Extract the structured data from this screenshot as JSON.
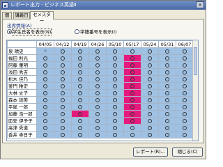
{
  "window": {
    "title": "レポート出力 - ビジネス英語Ⅱ",
    "close_label": "×"
  },
  "tabs": [
    {
      "label": "個別",
      "active": false
    },
    {
      "label": "講義日",
      "active": false
    },
    {
      "label": "セメスター",
      "active": true
    }
  ],
  "display_group": {
    "label": "出席情報(A)",
    "options": [
      {
        "label": "学生氏名を表示(N)",
        "selected": true
      },
      {
        "label": "学籍番号を表示(I)",
        "selected": false
      }
    ]
  },
  "grid": {
    "dates": [
      "04/05",
      "04/12",
      "04/19",
      "04/26",
      "05/10",
      "05/17",
      "05/24",
      "05/31",
      "06/07"
    ],
    "rows": [
      {
        "name": "泉 晴史",
        "marks": [
          "x",
          "o",
          "o",
          "o",
          "o",
          "o",
          "o",
          "o",
          "o"
        ]
      },
      {
        "name": "福田 利光",
        "marks": [
          "o",
          "o",
          "o",
          "o",
          "o",
          "o",
          "o",
          "o",
          "o"
        ]
      },
      {
        "name": "阿藤 董明",
        "marks": [
          "o",
          "o",
          "o",
          "o",
          "o",
          "o",
          "o",
          "o",
          "o"
        ]
      },
      {
        "name": "浅田 秀吉",
        "marks": [
          "o",
          "o",
          "o",
          "o",
          "o",
          "o",
          "o",
          "o",
          "o"
        ]
      },
      {
        "name": "松木 佳乃",
        "marks": [
          "o",
          "o",
          "o",
          "o",
          "o",
          "o",
          "o",
          "o",
          "o"
        ]
      },
      {
        "name": "釜門 稚史",
        "marks": [
          "o",
          "o",
          "o",
          "o",
          "o",
          "o",
          "o",
          "o",
          "o"
        ]
      },
      {
        "name": "大林 丈子",
        "marks": [
          "o",
          "o",
          "o",
          "o",
          "o",
          "o",
          "o",
          "o",
          "o"
        ]
      },
      {
        "name": "森本 読美",
        "marks": [
          "o",
          "o",
          "o",
          "o",
          "o",
          "o",
          "o",
          "o",
          "o"
        ]
      },
      {
        "name": "平尾 一郎",
        "marks": [
          "o",
          "o",
          "o",
          "o",
          "o",
          "o",
          "o",
          "o",
          "o"
        ]
      },
      {
        "name": "加藤 浩一郎",
        "marks": [
          "o",
          "o",
          "o",
          "o",
          "o",
          "o",
          "o",
          "o",
          "o"
        ]
      },
      {
        "name": "匝安 伊予子",
        "marks": [
          "o",
          "o",
          "o",
          "o",
          "o",
          "o",
          "o",
          "o",
          "o"
        ]
      },
      {
        "name": "高津 秀道",
        "marks": [
          "o",
          "o",
          "o",
          "o",
          "o",
          "o",
          "o",
          "o",
          "o"
        ]
      },
      {
        "name": "香井 寺日子",
        "marks": [
          "o",
          "o",
          "o",
          "o",
          "o",
          "o",
          "o",
          "o",
          "o"
        ]
      }
    ],
    "highlight_colors": {
      "cell": "#9fc1e3",
      "alert": "#e6197d"
    }
  },
  "buttons": {
    "report": "レポート(R)...",
    "close": "閉じる(C)"
  }
}
